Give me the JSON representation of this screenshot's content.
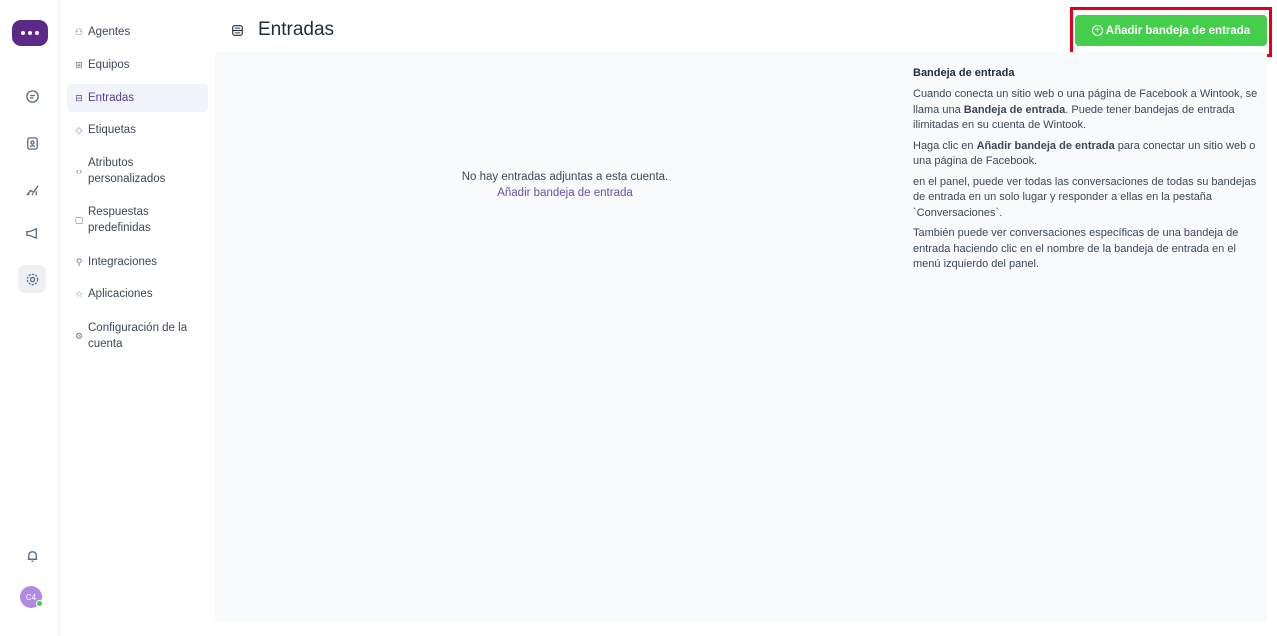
{
  "sidebar": {
    "items": [
      {
        "label": "Agentes",
        "icon": "agents-icon",
        "glyph": "⚇"
      },
      {
        "label": "Equipos",
        "icon": "teams-icon",
        "glyph": "⊞"
      },
      {
        "label": "Entradas",
        "icon": "inbox-icon",
        "glyph": "⊟"
      },
      {
        "label": "Etiquetas",
        "icon": "tag-icon",
        "glyph": "◇"
      },
      {
        "label": "Atributos personalizados",
        "icon": "code-icon",
        "glyph": "‹›"
      },
      {
        "label": "Respuestas predefinidas",
        "icon": "chat-icon",
        "glyph": "▢"
      },
      {
        "label": "Integraciones",
        "icon": "plug-icon",
        "glyph": "⚲"
      },
      {
        "label": "Aplicaciones",
        "icon": "apps-icon",
        "glyph": "☆"
      },
      {
        "label": "Configuración de la cuenta",
        "icon": "settings-icon",
        "glyph": "⚙"
      }
    ]
  },
  "rail": {
    "avatar_initials": "C4",
    "icons": [
      "conversations-icon",
      "contacts-icon",
      "reports-icon",
      "campaigns-icon",
      "settings-icon",
      "notifications-icon"
    ]
  },
  "header": {
    "title": "Entradas",
    "add_button_label": "Añadir bandeja de entrada"
  },
  "main": {
    "empty_message": "No hay entradas adjuntas a esta cuenta.",
    "empty_link": "Añadir bandeja de entrada"
  },
  "help": {
    "title": "Bandeja de entrada",
    "p1_a": "Cuando conecta un sitio web o una página de Facebook a Wintook, se llama una ",
    "p1_b": "Bandeja de entrada",
    "p1_c": ". Puede tener bandejas de entrada ilimitadas en su cuenta de Wintook.",
    "p2_a": "Haga clic en ",
    "p2_b": "Añadir bandeja de entrada",
    "p2_c": " para conectar un sitio web o una página de Facebook.",
    "p3": "en el panel, puede ver todas las conversaciones de todas su bandejas de entrada en un solo lugar y responder a ellas en la pestaña `Conversaciones`.",
    "p4": "También puede ver conversaciones específicas de una bandeja de entrada haciendo clic en el nombre de la bandeja de entrada en el menú izquierdo del panel."
  },
  "colors": {
    "brand": "#5b2a86",
    "primary_button": "#44ce4b",
    "highlight_frame": "#e4001b",
    "active_nav_text": "#5b3a9a"
  }
}
